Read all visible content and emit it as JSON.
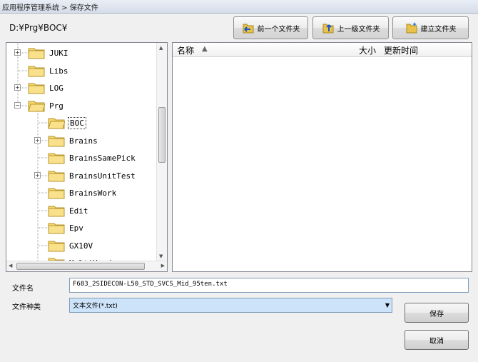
{
  "window": {
    "title": "应用程序管理系统 > 保存文件"
  },
  "current_path": "D:¥Prg¥BOC¥",
  "toolbar": {
    "back_label": "前一个文件夹",
    "up_label": "上一级文件夹",
    "new_folder_label": "建立文件夹"
  },
  "tree": {
    "items": [
      {
        "label": "JUKI",
        "expander": "+"
      },
      {
        "label": "Libs",
        "expander": ""
      },
      {
        "label": "LOG",
        "expander": "+"
      },
      {
        "label": "Prg",
        "expander": "−"
      },
      {
        "label": "BOC",
        "expander": ""
      },
      {
        "label": "Brains",
        "expander": "+"
      },
      {
        "label": "BrainsSamePick",
        "expander": ""
      },
      {
        "label": "BrainsUnitTest",
        "expander": "+"
      },
      {
        "label": "BrainsWork",
        "expander": ""
      },
      {
        "label": "Edit",
        "expander": ""
      },
      {
        "label": "Epv",
        "expander": ""
      },
      {
        "label": "GX10V",
        "expander": ""
      },
      {
        "label": "MultiHead",
        "expander": ""
      }
    ]
  },
  "file_list": {
    "col_name": "名称",
    "col_size": "大小",
    "col_updated": "更新时间"
  },
  "form": {
    "filename_label": "文件名",
    "filename_value": "F683_2SIDECON-L50_STD_SVCS_Mid_95ten.txt",
    "filetype_label": "文件种类",
    "filetype_value": "文本文件(*.txt)"
  },
  "buttons": {
    "save_label": "保存",
    "cancel_label": "取消"
  },
  "colors": {
    "folder": "#f5d76a",
    "selection_bg": "#cde3f9",
    "border": "#828790"
  }
}
